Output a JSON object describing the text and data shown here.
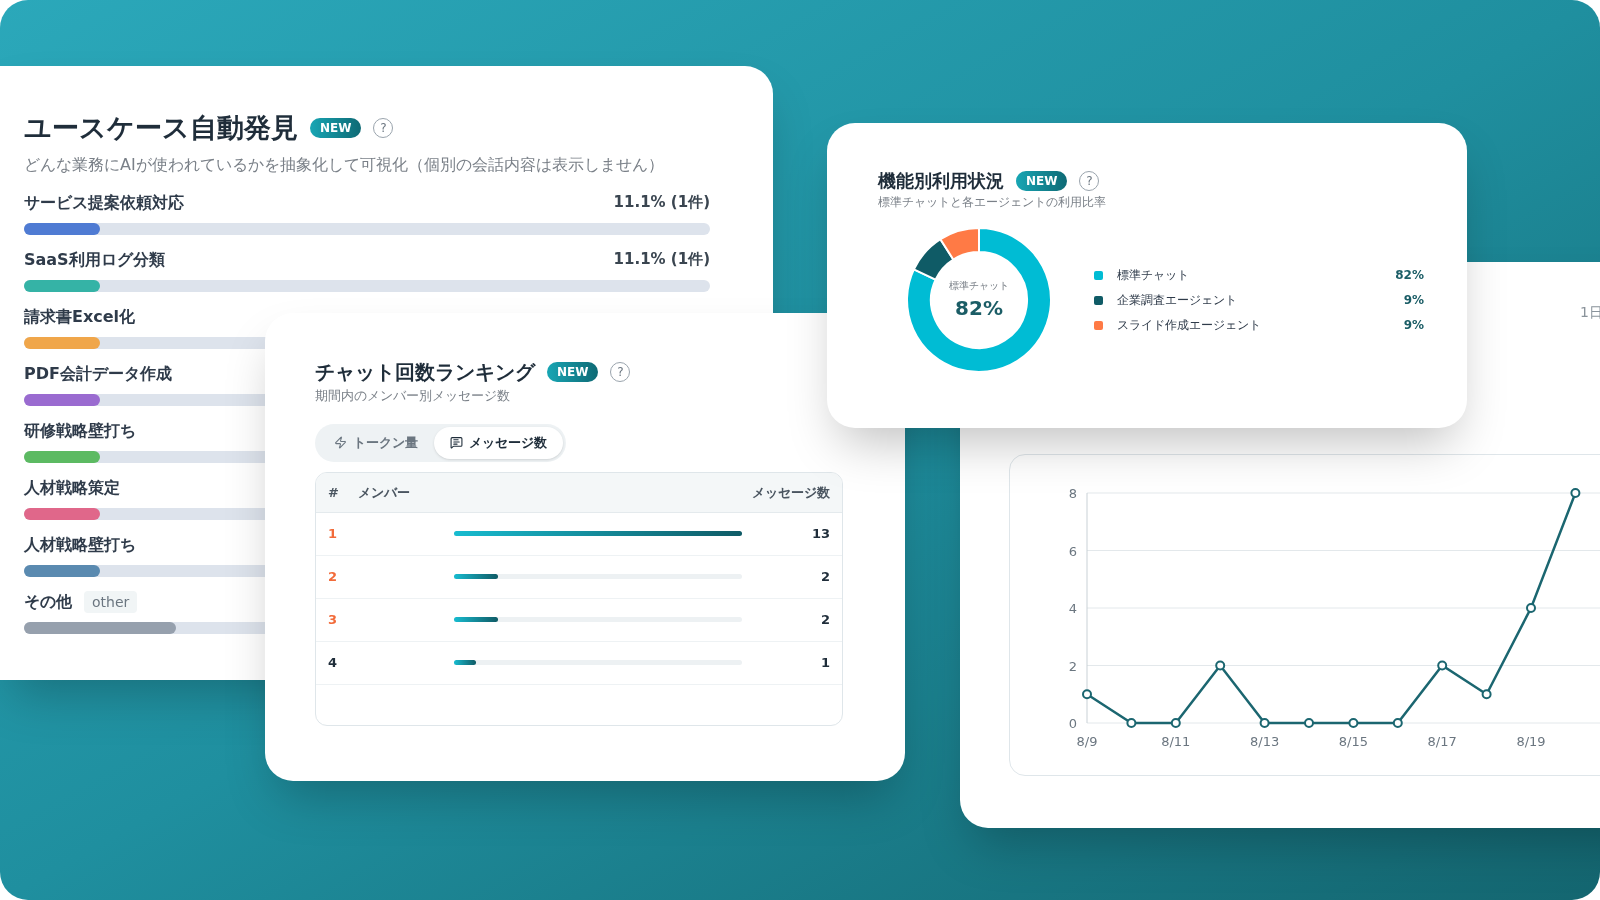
{
  "usecase_card": {
    "title": "ユースケース自動発見",
    "badge": "NEW",
    "help": "?",
    "subtitle": "どんな業務にAIが使われているかを抽象化して可視化（個別の会話内容は表示しません）",
    "items": [
      {
        "label": "サービス提案依頼対応",
        "share": "11.1% (1件)",
        "level": 0.111,
        "color": "#4f7bd3"
      },
      {
        "label": "SaaS利用ログ分類",
        "share": "11.1% (1件)",
        "level": 0.111,
        "color": "#35b3a6"
      },
      {
        "label": "請求書Excel化",
        "level": 0.111,
        "color": "#f0a64a"
      },
      {
        "label": "PDF会計データ作成",
        "level": 0.111,
        "color": "#9a6bd0"
      },
      {
        "label": "研修戦略壁打ち",
        "level": 0.111,
        "color": "#5cba62"
      },
      {
        "label": "人材戦略策定",
        "level": 0.111,
        "color": "#e0678a"
      },
      {
        "label": "人材戦略壁打ち",
        "level": 0.111,
        "color": "#5a8ab0"
      },
      {
        "label": "その他",
        "tag": "other",
        "level": 0.222,
        "color": "#96a0ad"
      }
    ]
  },
  "ranking_card": {
    "title": "チャット回数ランキング",
    "badge": "NEW",
    "help": "?",
    "subtitle": "期間内のメンバー別メッセージ数",
    "toggle": [
      {
        "label": "トークン量",
        "kind": "tokens",
        "selected": false
      },
      {
        "label": "メッセージ数",
        "kind": "messages",
        "selected": true
      }
    ],
    "table": {
      "columns": [
        "#",
        "メンバー",
        "メッセージ数"
      ],
      "rows": [
        {
          "rank": "1",
          "color": "#f26b3a",
          "level": 1,
          "count": "13"
        },
        {
          "rank": "2",
          "color": "#f26b3a",
          "level": 0.154,
          "count": "2"
        },
        {
          "rank": "3",
          "color": "#f26b3a",
          "level": 0.154,
          "count": "2"
        },
        {
          "rank": "4",
          "color": "#1f2d3a",
          "level": 0.077,
          "count": "1"
        }
      ]
    }
  },
  "usage_card": {
    "title": "機能別利用状況",
    "badge": "NEW",
    "help": "?",
    "subtitle": "標準チャットと各エージェントの利用比率",
    "center": {
      "label": "標準チャット",
      "value": "82%"
    },
    "legend": [
      {
        "label": "標準チャット",
        "value": "82%",
        "color": "#00bcd4"
      },
      {
        "label": "企業調査エージェント",
        "value": "9%",
        "color": "#0f5b66"
      },
      {
        "label": "スライド作成エージェント",
        "value": "9%",
        "color": "#ff7a45"
      }
    ],
    "chart_data": {
      "type": "donut",
      "values": [
        82,
        9,
        9
      ]
    }
  },
  "trend_card": {
    "corner_label": "1日",
    "chart_data": {
      "type": "line",
      "categories": [
        "8/9",
        null,
        "8/11",
        null,
        "8/13",
        null,
        "8/15",
        null,
        "8/17",
        null,
        "8/19",
        null
      ],
      "series": [
        {
          "color": "#1b6670",
          "marker": "circle",
          "values": [
            1,
            0,
            0,
            2,
            0,
            0,
            0,
            0,
            2,
            1,
            4,
            8
          ]
        }
      ],
      "grid": true,
      "ylim": [
        0,
        8
      ],
      "yticks": [
        0,
        2,
        4,
        6,
        8
      ]
    }
  }
}
